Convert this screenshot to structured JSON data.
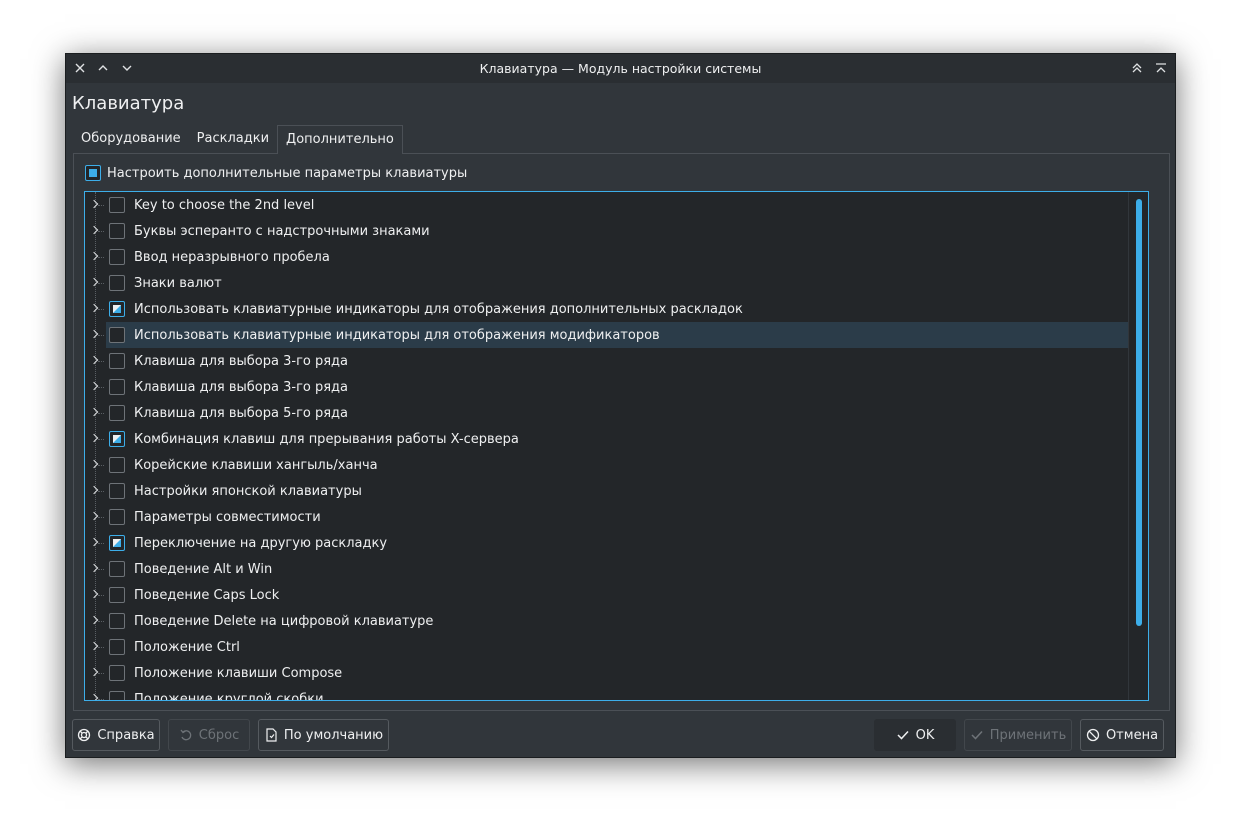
{
  "window": {
    "title": "Клавиатура — Модуль настройки системы"
  },
  "page": {
    "title": "Клавиатура"
  },
  "tabs": [
    {
      "label": "Оборудование",
      "active": false
    },
    {
      "label": "Раскладки",
      "active": false
    },
    {
      "label": "Дополнительно",
      "active": true
    }
  ],
  "master": {
    "label": "Настроить дополнительные параметры клавиатуры",
    "checked": true
  },
  "tree": {
    "items": [
      {
        "label": "Key to choose the 2nd level",
        "state": "unchecked"
      },
      {
        "label": "Буквы эсперанто с надстрочными знаками",
        "state": "unchecked"
      },
      {
        "label": "Ввод неразрывного пробела",
        "state": "unchecked"
      },
      {
        "label": "Знаки валют",
        "state": "unchecked"
      },
      {
        "label": "Использовать клавиатурные индикаторы для отображения дополнительных раскладок",
        "state": "partial"
      },
      {
        "label": "Использовать клавиатурные индикаторы для отображения модификаторов",
        "state": "unchecked",
        "highlighted": true
      },
      {
        "label": "Клавиша для выбора 3-го ряда",
        "state": "unchecked"
      },
      {
        "label": "Клавиша для выбора 3-го ряда",
        "state": "unchecked"
      },
      {
        "label": "Клавиша для выбора 5-го ряда",
        "state": "unchecked"
      },
      {
        "label": "Комбинация клавиш для прерывания работы X-сервера",
        "state": "partial"
      },
      {
        "label": "Корейские клавиши хангыль/ханча",
        "state": "unchecked"
      },
      {
        "label": "Настройки японской клавиатуры",
        "state": "unchecked"
      },
      {
        "label": "Параметры совместимости",
        "state": "unchecked"
      },
      {
        "label": "Переключение на другую раскладку",
        "state": "partial"
      },
      {
        "label": "Поведение Alt и Win",
        "state": "unchecked"
      },
      {
        "label": "Поведение Caps Lock",
        "state": "unchecked"
      },
      {
        "label": "Поведение Delete на цифровой клавиатуре",
        "state": "unchecked"
      },
      {
        "label": "Положение Ctrl",
        "state": "unchecked"
      },
      {
        "label": "Положение клавиши Compose",
        "state": "unchecked"
      },
      {
        "label": "Положение круглой скобки",
        "state": "unchecked"
      }
    ]
  },
  "buttons": {
    "help": "Справка",
    "reset": "Сброс",
    "defaults": "По умолчанию",
    "ok": "OK",
    "apply": "Применить",
    "cancel": "Отмена"
  },
  "colors": {
    "accent": "#3daee9",
    "window_bg": "#31363b",
    "view_bg": "#232629",
    "highlight_row": "#2b3c49"
  }
}
